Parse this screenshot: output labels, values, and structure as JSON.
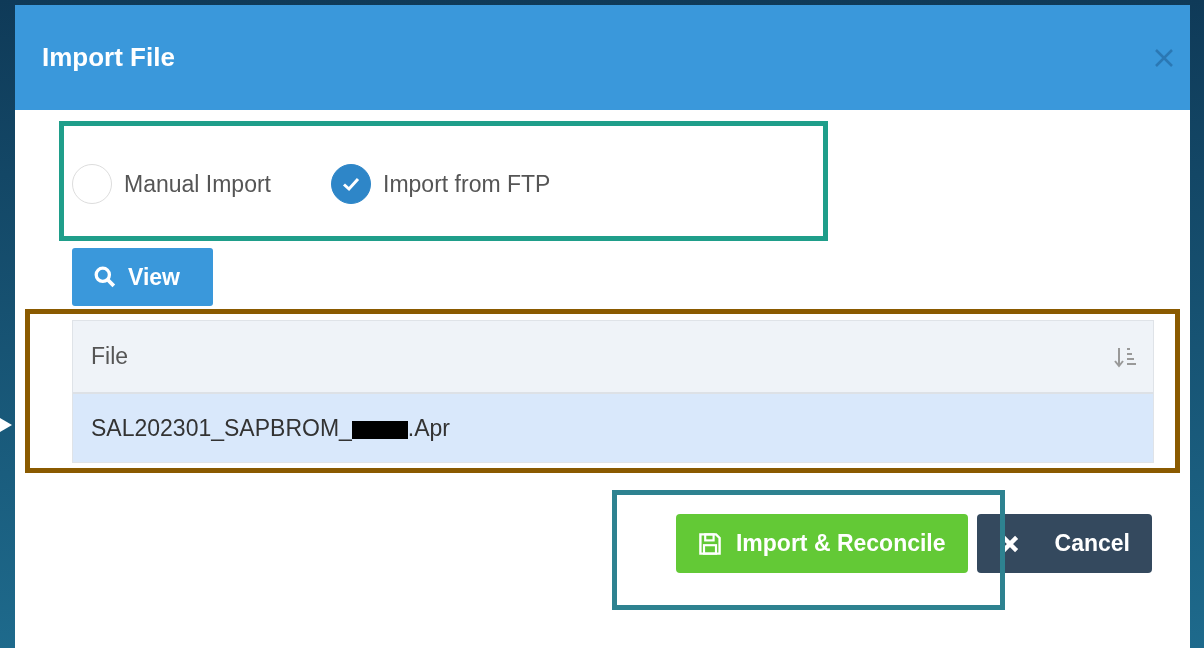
{
  "dialog": {
    "title": "Import File"
  },
  "import_options": [
    {
      "label": "Manual Import",
      "selected": false
    },
    {
      "label": "Import from FTP",
      "selected": true
    }
  ],
  "view_button": "View",
  "table": {
    "columns": [
      "File"
    ],
    "rows": [
      {
        "file_prefix": "SAL202301_SAPBROM_",
        "file_suffix": ".Apr",
        "selected": true
      }
    ]
  },
  "buttons": [
    {
      "kind": "primary",
      "label": "Import & Reconcile"
    },
    {
      "kind": "cancel",
      "label": "Cancel"
    }
  ],
  "highlights": [
    {
      "color": "#1f9e8a"
    },
    {
      "color": "#8a5a00"
    },
    {
      "color": "#2e8290"
    }
  ]
}
